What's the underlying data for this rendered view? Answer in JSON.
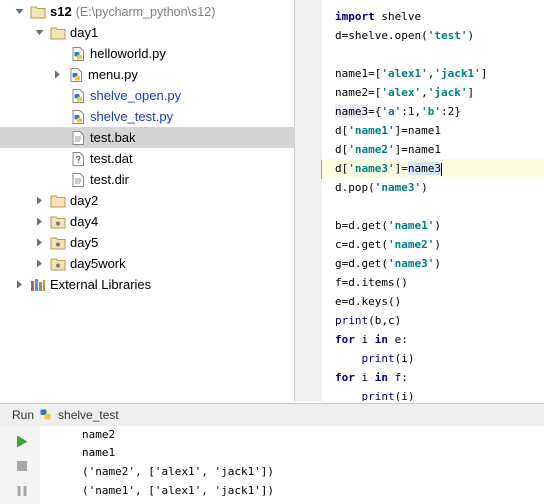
{
  "project_tree": {
    "root": {
      "name": "s12",
      "path": "(E:\\pycharm_python\\s12)"
    },
    "day1": {
      "name": "day1",
      "files": [
        {
          "name": "helloworld.py",
          "type": "python",
          "modified": false
        },
        {
          "name": "menu.py",
          "type": "python-package",
          "modified": false
        },
        {
          "name": "shelve_open.py",
          "type": "python",
          "modified": true
        },
        {
          "name": "shelve_test.py",
          "type": "python",
          "modified": true
        },
        {
          "name": "test.bak",
          "type": "text",
          "selected": true
        },
        {
          "name": "test.dat",
          "type": "unknown"
        },
        {
          "name": "test.dir",
          "type": "text"
        }
      ]
    },
    "folders": [
      "day2",
      "day4",
      "day5",
      "day5work"
    ],
    "external": "External Libraries"
  },
  "editor": {
    "lines": [
      "import shelve",
      "d=shelve.open('test')",
      "",
      "name1=['alex1','jack1']",
      "name2=['alex','jack']",
      "name3={'a':1,'b':2}",
      "d['name1']=name1",
      "d['name2']=name1",
      "d['name3']=name3",
      "d.pop('name3')",
      "",
      "b=d.get('name1')",
      "c=d.get('name2')",
      "g=d.get('name3')",
      "f=d.items()",
      "e=d.keys()",
      "print(b,c)",
      "for i in e:",
      "    print(i)",
      "for i in f:",
      "    print(i)"
    ]
  },
  "run_panel": {
    "tab_label": "Run",
    "config_name": "shelve_test",
    "output": [
      "name2",
      "name1",
      "('name2', ['alex1', 'jack1'])",
      "('name1', ['alex1', 'jack1'])"
    ]
  },
  "colors": {
    "keyword": "#000080",
    "string": "#008080",
    "modified_file": "#1a3fb5",
    "selection": "#d5d5d5",
    "current_line": "#fdfde0"
  }
}
